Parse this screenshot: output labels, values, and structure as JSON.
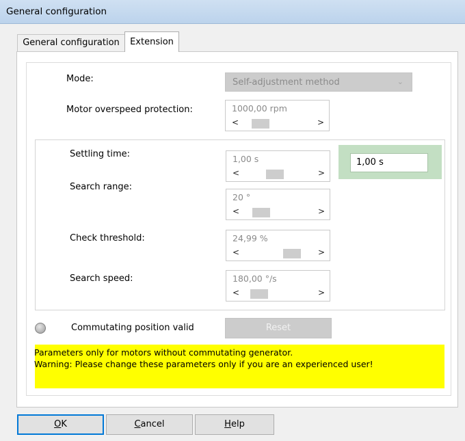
{
  "window": {
    "title": "General configuration"
  },
  "tabs": [
    {
      "label": "General configuration",
      "active": false
    },
    {
      "label": "Extension",
      "active": true
    }
  ],
  "mode": {
    "label": "Mode:",
    "value": "Self-adjustment method",
    "icon": "chevron-down-icon"
  },
  "overspeed": {
    "label": "Motor overspeed protection:",
    "value": "1000,00 rpm",
    "slider_fraction": 0.15
  },
  "settling": {
    "label": "Settling time:",
    "value": "1,00 s",
    "slider_fraction": 0.35,
    "display_value": "1,00 s"
  },
  "search_range": {
    "label": "Search range:",
    "value": "20 °",
    "slider_fraction": 0.15
  },
  "check_threshold": {
    "label": "Check threshold:",
    "value": "24,99 %",
    "slider_fraction": 0.6
  },
  "search_speed": {
    "label": "Search speed:",
    "value": "180,00 °/s",
    "slider_fraction": 0.12
  },
  "commutating": {
    "label": "Commutating position valid",
    "reset_label": "Reset"
  },
  "warning": {
    "line1": "Parameters only for motors without commutating generator.",
    "line2": "Warning: Please change these parameters only if you are an experienced user!",
    "color": "#ffff00"
  },
  "buttons": {
    "ok_accel": "O",
    "ok_rest": "K",
    "cancel_accel": "C",
    "cancel_rest": "ancel",
    "help_accel": "H",
    "help_rest": "elp"
  },
  "scroll": {
    "left": "<",
    "right": ">"
  }
}
